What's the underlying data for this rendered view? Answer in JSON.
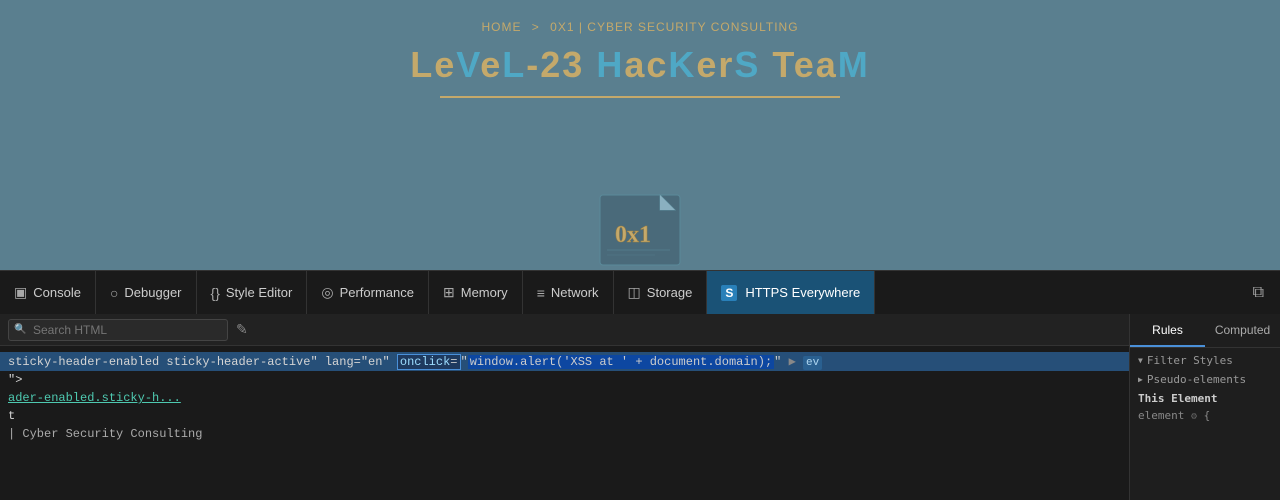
{
  "website": {
    "breadcrumb": {
      "home": "HOME",
      "sep": ">",
      "path": "0X1 | CYBER SECURITY CONSULTING"
    },
    "title": {
      "part1_normal": "Le",
      "part1_accent": "V",
      "part2_normal": "e",
      "part2_accent": "L",
      "part3": "-23 ",
      "part4_accent": "H",
      "part5_normal": "ac",
      "part6_accent": "K",
      "part7_normal": "er",
      "part8_accent": "S",
      "part9_normal": " Tea",
      "part10_accent": "M"
    },
    "logo_text": "0x1"
  },
  "devtools": {
    "tabs": [
      {
        "label": "Console",
        "icon": "▣",
        "active": false
      },
      {
        "label": "Debugger",
        "icon": "○",
        "active": false
      },
      {
        "label": "Style Editor",
        "icon": "{}",
        "active": false
      },
      {
        "label": "Performance",
        "icon": "◎",
        "active": false
      },
      {
        "label": "Memory",
        "icon": "⊞",
        "active": false
      },
      {
        "label": "Network",
        "icon": "≡",
        "active": false
      },
      {
        "label": "Storage",
        "icon": "◫",
        "active": false
      },
      {
        "label": "HTTPS Everywhere",
        "icon": "S",
        "active": true
      }
    ],
    "search_placeholder": "Search HTML",
    "html_lines": [
      {
        "id": 1,
        "content": "sticky-header-enabled sticky-header-active\" lang=\"en\"",
        "onclick": "onclick=",
        "onclick_value": "window.alert('XSS at ' + document.domai",
        "arrow": ">",
        "selected": true
      },
      {
        "id": 2,
        "content": "\">'",
        "selected": false
      },
      {
        "id": 3,
        "content": "ader-enabled.sticky-h...",
        "link": true,
        "selected": false
      },
      {
        "id": 4,
        "content": "t",
        "selected": false
      },
      {
        "id": 5,
        "content": "| Cyber Security Consulting",
        "selected": false
      }
    ],
    "styles": {
      "tabs": [
        {
          "label": "Rules",
          "active": true
        },
        {
          "label": "Computed",
          "active": false
        }
      ],
      "filter_styles": "Filter Styles",
      "pseudo_elements": "Pseudo-elements",
      "this_element": "This Element",
      "element_rule": "element",
      "element_brace": "{"
    }
  }
}
